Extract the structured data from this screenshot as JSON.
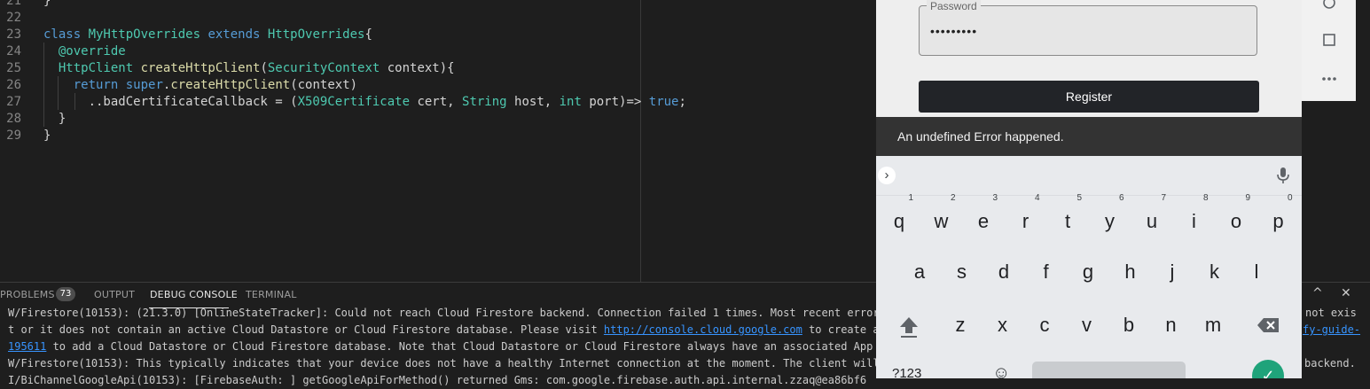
{
  "editor": {
    "lines": [
      {
        "num": "21",
        "parts": [
          {
            "t": "}",
            "c": ""
          }
        ]
      },
      {
        "num": "22",
        "parts": []
      },
      {
        "num": "23",
        "parts": [
          {
            "t": "class ",
            "c": "kw"
          },
          {
            "t": "MyHttpOverrides ",
            "c": "cls"
          },
          {
            "t": "extends ",
            "c": "kw"
          },
          {
            "t": "HttpOverrides",
            "c": "cls"
          },
          {
            "t": "{",
            "c": ""
          }
        ]
      },
      {
        "num": "24",
        "parts": [
          {
            "t": "  @override",
            "c": "ann"
          }
        ]
      },
      {
        "num": "25",
        "parts": [
          {
            "t": "  ",
            "c": ""
          },
          {
            "t": "HttpClient ",
            "c": "cls"
          },
          {
            "t": "createHttpClient",
            "c": "fn"
          },
          {
            "t": "(",
            "c": ""
          },
          {
            "t": "SecurityContext ",
            "c": "cls"
          },
          {
            "t": "context){",
            "c": ""
          }
        ]
      },
      {
        "num": "26",
        "parts": [
          {
            "t": "    ",
            "c": ""
          },
          {
            "t": "return ",
            "c": "kw"
          },
          {
            "t": "super",
            "c": "kw"
          },
          {
            "t": ".",
            "c": ""
          },
          {
            "t": "createHttpClient",
            "c": "fn"
          },
          {
            "t": "(context)",
            "c": ""
          }
        ]
      },
      {
        "num": "27",
        "parts": [
          {
            "t": "      ..badCertificateCallback = (",
            "c": ""
          },
          {
            "t": "X509Certificate ",
            "c": "cls"
          },
          {
            "t": "cert, ",
            "c": ""
          },
          {
            "t": "String ",
            "c": "cls"
          },
          {
            "t": "host, ",
            "c": ""
          },
          {
            "t": "int ",
            "c": "cls"
          },
          {
            "t": "port)=> ",
            "c": ""
          },
          {
            "t": "true",
            "c": "kw"
          },
          {
            "t": ";",
            "c": ""
          }
        ]
      },
      {
        "num": "28",
        "parts": [
          {
            "t": "  }",
            "c": ""
          }
        ]
      },
      {
        "num": "29",
        "parts": [
          {
            "t": "}",
            "c": ""
          }
        ]
      }
    ]
  },
  "panel": {
    "tabs": {
      "problems": "PROBLEMS",
      "problems_count": "73",
      "output": "OUTPUT",
      "debug_console": "DEBUG CONSOLE",
      "terminal": "TERMINAL"
    },
    "controls": {
      "maximize": "^",
      "close": "✕"
    },
    "console_lines": [
      [
        {
          "t": "W/Firestore(10153): (21.3.0) [OnlineStateTracker]: Could not reach Cloud Firestore backend. Connection failed 1 times. Most recent error: St",
          "l": false
        }
      ],
      [
        {
          "t": "t or it does not contain an active Cloud Datastore or Cloud Firestore database. Please visit ",
          "l": false
        },
        {
          "t": "http://console.cloud.google.com",
          "l": true
        },
        {
          "t": " to create a pro",
          "l": false
        }
      ],
      [
        {
          "t": "195611",
          "l": true
        },
        {
          "t": " to add a Cloud Datastore or Cloud Firestore database. Note that Cloud Datastore or Cloud Firestore always have an associated App Engi",
          "l": false
        }
      ],
      [
        {
          "t": "W/Firestore(10153): This typically indicates that your device does not have a healthy Internet connection at the moment. The client will ope",
          "l": false
        }
      ],
      [
        {
          "t": "I/BiChannelGoogleApi(10153): [FirebaseAuth: ] getGoogleApiForMethod() returned Gms: com.google.firebase.auth.api.internal.zzaq@ea86bf6",
          "l": false
        }
      ]
    ],
    "right_fragments": {
      "line1": "not exis",
      "line2": "fy-guide-",
      "line4": "backend."
    }
  },
  "emulator": {
    "password_label": "Password",
    "password_value": "•••••••••",
    "register_label": "Register",
    "snackbar_text": "An undefined Error happened.",
    "keyboard": {
      "row1": [
        {
          "k": "q",
          "h": "1"
        },
        {
          "k": "w",
          "h": "2"
        },
        {
          "k": "e",
          "h": "3"
        },
        {
          "k": "r",
          "h": "4"
        },
        {
          "k": "t",
          "h": "5"
        },
        {
          "k": "y",
          "h": "6"
        },
        {
          "k": "u",
          "h": "7"
        },
        {
          "k": "i",
          "h": "8"
        },
        {
          "k": "o",
          "h": "9"
        },
        {
          "k": "p",
          "h": "0"
        }
      ],
      "row2": [
        "a",
        "s",
        "d",
        "f",
        "g",
        "h",
        "j",
        "k",
        "l"
      ],
      "row3": [
        "z",
        "x",
        "c",
        "v",
        "b",
        "n",
        "m"
      ],
      "symbols_label": "?123"
    }
  },
  "icons": {
    "expand": "chevron-right-icon",
    "mic": "mic-icon",
    "shift": "shift-icon",
    "backspace": "backspace-icon",
    "emoji": "emoji-icon",
    "enter": "check-icon",
    "home": "circle-icon",
    "overview": "square-icon",
    "more": "more-icon"
  }
}
